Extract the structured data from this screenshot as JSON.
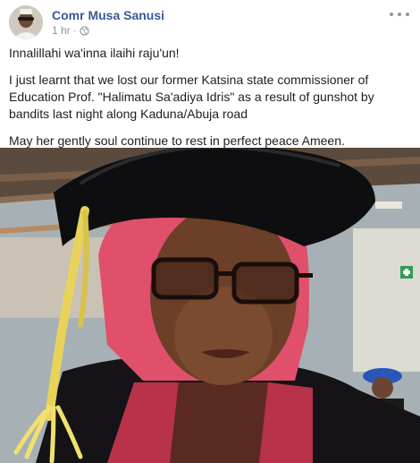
{
  "post": {
    "author": "Comr Musa Sanusi",
    "time": "1 hr",
    "separator": "·",
    "privacy_icon": "globe-icon",
    "more_icon": "ellipsis-icon",
    "paragraphs": [
      "Innalillahi wa'inna ilaihi raju'un!",
      "I just learnt that we lost our former Katsina state commissioner of Education Prof. \"Halimatu Sa'adiya Idris\" as a result of gunshot by bandits last night along Kaduna/Abuja road",
      "May her gently soul continue to rest in perfect peace Ameen."
    ]
  },
  "colors": {
    "author_link": "#385898",
    "meta_text": "#90949c",
    "gown_red": "#b8324a",
    "cap_black": "#0e0e10",
    "headscarf_pink": "#e0506a",
    "tassel_gold": "#e8d35a"
  }
}
